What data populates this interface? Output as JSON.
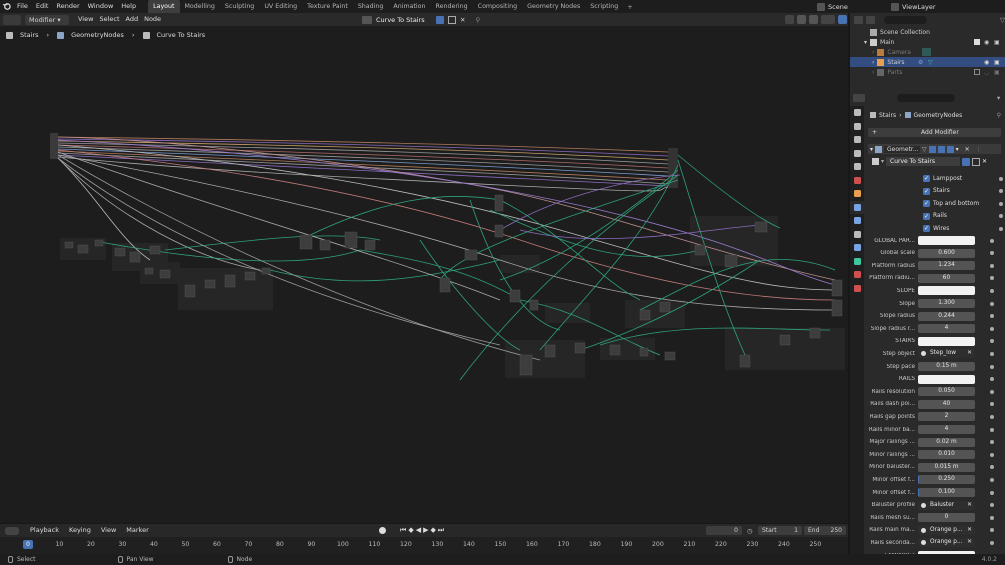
{
  "topbar": {
    "menus": [
      "File",
      "Edit",
      "Render",
      "Window",
      "Help"
    ],
    "workspaces": [
      "Layout",
      "Modelling",
      "Sculpting",
      "UV Editing",
      "Texture Paint",
      "Shading",
      "Animation",
      "Rendering",
      "Compositing",
      "Geometry Nodes",
      "Scripting"
    ],
    "active_workspace": "Layout",
    "scene": "Scene",
    "view_layer": "ViewLayer"
  },
  "editor_header": {
    "mode": "Modifier",
    "menus": [
      "View",
      "Select",
      "Add",
      "Node"
    ],
    "node_group": "Curve To Stairs"
  },
  "breadcrumb": [
    "Stairs",
    "GeometryNodes",
    "Curve To Stairs"
  ],
  "outliner": {
    "title": "Scene Collection",
    "items": [
      "Main",
      "Camera",
      "Stairs",
      "Parts"
    ]
  },
  "properties": {
    "breadcrumb": [
      "Stairs",
      "GeometryNodes"
    ],
    "add_modifier": "Add Modifier",
    "modifier_name": "Geometr...",
    "node_group": "Curve To Stairs",
    "checkboxes": [
      "Lamppost",
      "Stairs",
      "Top and bottom",
      "Rails",
      "Wires"
    ],
    "rows": [
      {
        "label": "GLOBAL PAR...",
        "value": "",
        "type": "text"
      },
      {
        "label": "Global scale",
        "value": "0.600"
      },
      {
        "label": "Platform radius",
        "value": "1.234"
      },
      {
        "label": "Platform radiu...",
        "value": "60"
      },
      {
        "label": "SLOPE",
        "value": "",
        "type": "text"
      },
      {
        "label": "Slope",
        "value": "1.300"
      },
      {
        "label": "Slope radius",
        "value": "0.244"
      },
      {
        "label": "Slope radius r...",
        "value": "4"
      },
      {
        "label": "STAIRS",
        "value": "",
        "type": "text"
      },
      {
        "label": "Step object",
        "value": "Step_low",
        "type": "obj"
      },
      {
        "label": "Step pace",
        "value": "0.15 m"
      },
      {
        "label": "RAILS",
        "value": "",
        "type": "text"
      },
      {
        "label": "Rails resolution",
        "value": "0.050"
      },
      {
        "label": "Rails dash poi...",
        "value": "40"
      },
      {
        "label": "Rails gap points",
        "value": "2"
      },
      {
        "label": "Rails minor ba...",
        "value": "4"
      },
      {
        "label": "Major railings ...",
        "value": "0.02 m"
      },
      {
        "label": "Minor railings ...",
        "value": "0.010"
      },
      {
        "label": "Minor baluster...",
        "value": "0.015 m"
      },
      {
        "label": "Minor offset f...",
        "value": "0.250",
        "type": "slider"
      },
      {
        "label": "Minor offset f...",
        "value": "0.100",
        "type": "slider"
      },
      {
        "label": "Baluster profile",
        "value": "Baluster",
        "type": "obj"
      },
      {
        "label": "Rails mesh su...",
        "value": "0"
      },
      {
        "label": "Rails main ma...",
        "value": "Orange p...",
        "type": "mat"
      },
      {
        "label": "Rails seconda...",
        "value": "Orange p...",
        "type": "mat"
      },
      {
        "label": "LAMPPOST",
        "value": "",
        "type": "text"
      }
    ]
  },
  "timeline": {
    "menus": [
      "Playback",
      "Keying",
      "View",
      "Marker"
    ],
    "current_frame": "0",
    "start_label": "Start",
    "start": "1",
    "end_label": "End",
    "end": "250",
    "ticks": [
      "0",
      "10",
      "20",
      "30",
      "40",
      "50",
      "60",
      "70",
      "80",
      "90",
      "100",
      "110",
      "120",
      "130",
      "140",
      "150",
      "160",
      "170",
      "180",
      "190",
      "200",
      "210",
      "220",
      "230",
      "240",
      "250"
    ]
  },
  "status": {
    "items": [
      "Select",
      "Pan View",
      "Node"
    ],
    "version": "4.0.2"
  },
  "colors": {
    "accent": "#4772b3",
    "selected": "#334d80",
    "wire_green": "#2ea37a",
    "wire_gray": "#9a9a9a"
  }
}
